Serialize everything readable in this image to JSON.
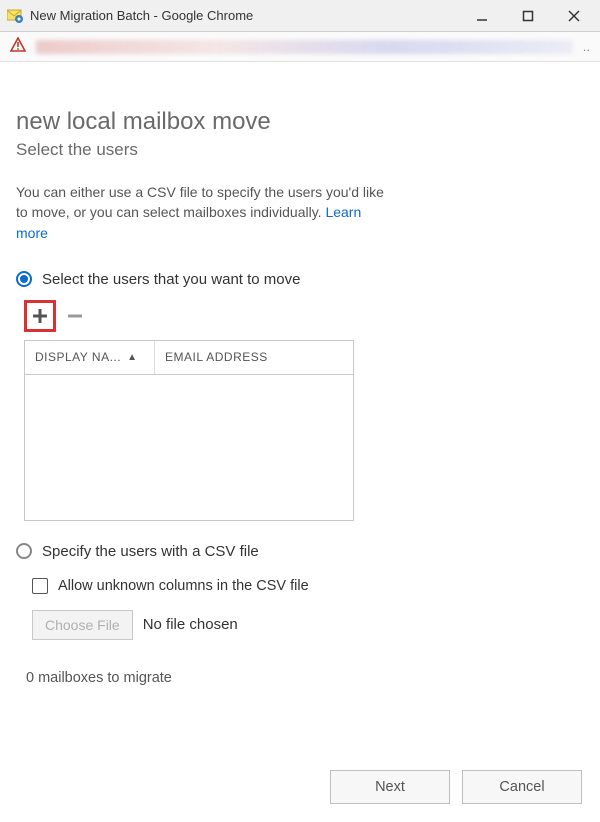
{
  "window": {
    "title": "New Migration Batch - Google Chrome"
  },
  "page": {
    "heading": "new local mailbox move",
    "subheading": "Select the users",
    "description_prefix": "You can either use a CSV file to specify the users you'd like to move, or you can select mailboxes individually. ",
    "learn_more": "Learn more"
  },
  "options": {
    "select_users_label": "Select the users that you want to move",
    "csv_label": "Specify the users with a CSV file",
    "selected": "select_users"
  },
  "table": {
    "columns": {
      "display_name": "DISPLAY NA...",
      "email_address": "EMAIL ADDRESS"
    },
    "rows": []
  },
  "csv_section": {
    "allow_unknown_label": "Allow unknown columns in the CSV file",
    "allow_unknown_checked": false,
    "choose_file_label": "Choose File",
    "no_file_label": "No file chosen"
  },
  "status": {
    "mailboxes_text": "0 mailboxes to migrate"
  },
  "footer": {
    "next": "Next",
    "cancel": "Cancel"
  },
  "icons": {
    "add": "plus-icon",
    "remove": "minus-icon",
    "sort": "sort-asc-icon"
  }
}
